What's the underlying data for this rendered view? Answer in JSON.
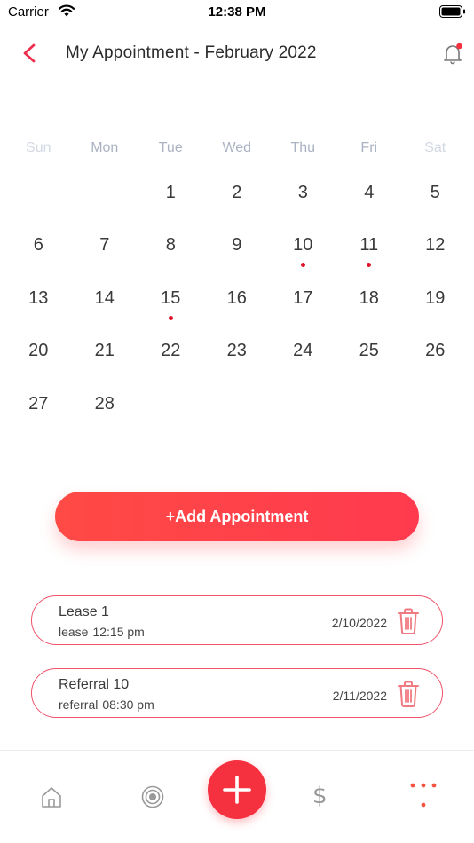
{
  "status_bar": {
    "carrier": "Carrier",
    "time": "12:38 PM"
  },
  "header": {
    "title": "My Appointment - February 2022"
  },
  "calendar": {
    "weekdays": [
      "Sun",
      "Mon",
      "Tue",
      "Wed",
      "Thu",
      "Fri",
      "Sat"
    ],
    "days": [
      "",
      "",
      "1",
      "2",
      "3",
      "4",
      "5",
      "6",
      "7",
      "8",
      "9",
      "10",
      "11",
      "12",
      "13",
      "14",
      "15",
      "16",
      "17",
      "18",
      "19",
      "20",
      "21",
      "22",
      "23",
      "24",
      "25",
      "26",
      "27",
      "28",
      "",
      "",
      "",
      "",
      ""
    ],
    "marked_days": [
      "10",
      "11",
      "15"
    ]
  },
  "add_button": {
    "label": "+Add Appointment"
  },
  "appointments": [
    {
      "title": "Lease 1",
      "type": "lease",
      "time": "12:15 pm",
      "date": "2/10/2022"
    },
    {
      "title": "Referral 10",
      "type": "referral",
      "time": "08:30 pm",
      "date": "2/11/2022"
    }
  ],
  "tab_bar": {
    "items": [
      {
        "icon": "home-icon"
      },
      {
        "icon": "target-icon"
      },
      {
        "icon": "plus-icon"
      },
      {
        "icon": "dollar-icon",
        "symbol": "$"
      },
      {
        "icon": "more-icon"
      }
    ]
  },
  "colors": {
    "accent": "#f5303f",
    "dot": "#e0162b",
    "card_border": "#f0536a"
  }
}
